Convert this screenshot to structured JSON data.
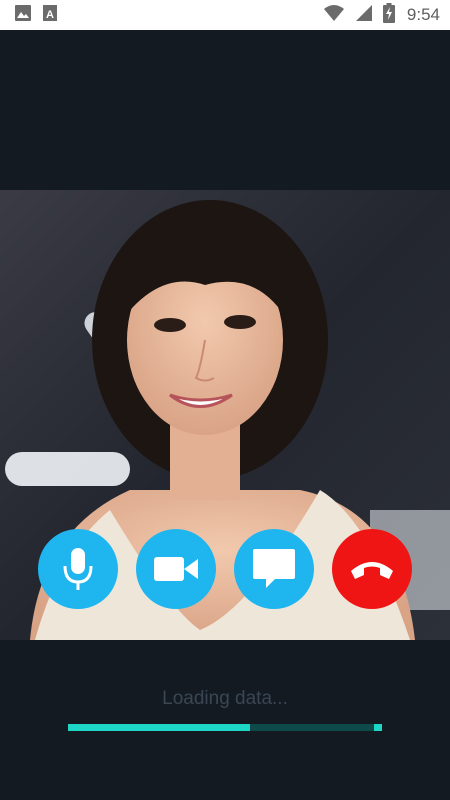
{
  "status_bar": {
    "time": "9:54",
    "left_icons": [
      "image-icon",
      "text-icon"
    ],
    "right_icons": [
      "wifi-icon",
      "signal-icon",
      "battery-charging-icon"
    ]
  },
  "video": {
    "description_icon": "remote-video-feed"
  },
  "controls": {
    "buttons": [
      {
        "name": "mute-button",
        "icon": "microphone-icon",
        "color": "#1fb6f0"
      },
      {
        "name": "video-toggle-button",
        "icon": "video-camera-icon",
        "color": "#1fb6f0"
      },
      {
        "name": "chat-button",
        "icon": "message-icon",
        "color": "#1fb6f0"
      },
      {
        "name": "end-call-button",
        "icon": "hang-up-icon",
        "color": "#f01515"
      }
    ]
  },
  "loading": {
    "text": "Loading data...",
    "progress": 0.58
  },
  "colors": {
    "background": "#131a22",
    "accent": "#1fb6f0",
    "danger": "#f01515",
    "progress": "#1ed6c6"
  }
}
